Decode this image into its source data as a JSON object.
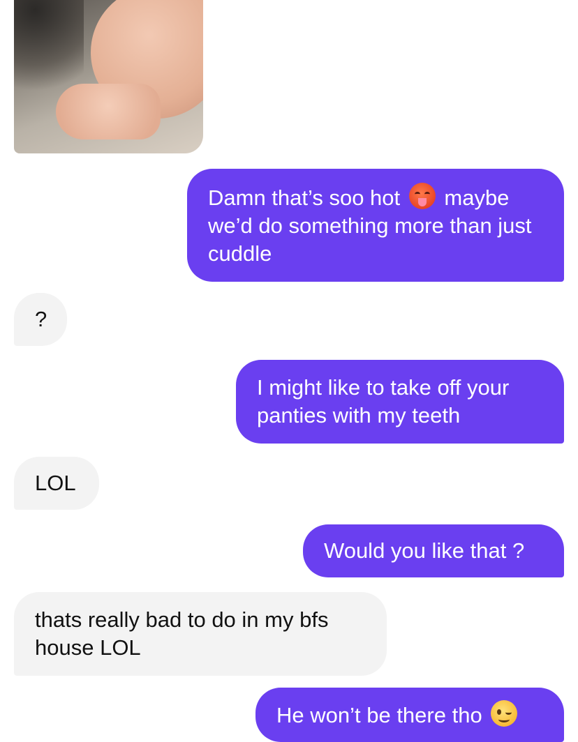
{
  "conversation": {
    "photo_alt": "received-photo",
    "messages": [
      {
        "direction": "outgoing",
        "text_before": "Damn that’s soo hot",
        "emoji": "hot-face-icon",
        "text_after": "maybe we’d do something more than just cuddle"
      },
      {
        "direction": "incoming",
        "text": "?"
      },
      {
        "direction": "outgoing",
        "text": "I might like to take off your panties with my teeth"
      },
      {
        "direction": "incoming",
        "text": "LOL"
      },
      {
        "direction": "outgoing",
        "text": "Would you like that ?"
      },
      {
        "direction": "incoming",
        "text": "thats really bad to do in my bfs house LOL"
      },
      {
        "direction": "outgoing",
        "text_before": "He won’t be there tho",
        "emoji": "winking-face-icon"
      }
    ]
  },
  "colors": {
    "outgoing_bubble": "#6a3ff0",
    "incoming_bubble": "#f3f3f3",
    "outgoing_text": "#ffffff",
    "incoming_text": "#111111"
  }
}
